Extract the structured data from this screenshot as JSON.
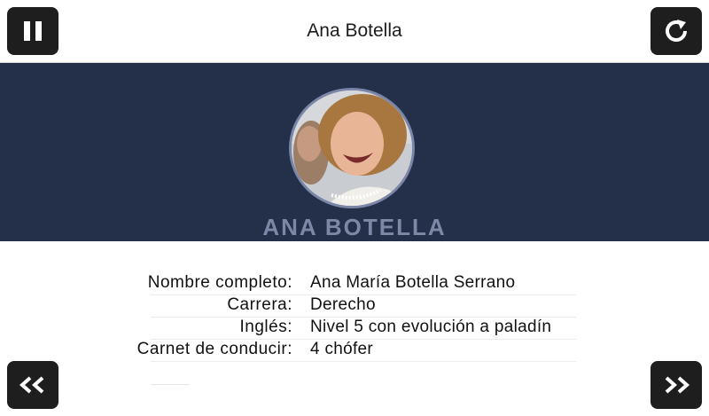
{
  "header": {
    "title": "Ana Botella",
    "pause_icon": "pause-icon",
    "reload_icon": "reload-icon"
  },
  "banner": {
    "name": "ANA BOTELLA",
    "background_color": "#24304a",
    "name_color": "#7c88a6"
  },
  "profile": {
    "fields": [
      {
        "label": "Nombre completo:",
        "value": "Ana María Botella Serrano"
      },
      {
        "label": "Carrera:",
        "value": "Derecho"
      },
      {
        "label": "Inglés:",
        "value": "Nivel 5 con evolución a paladín"
      },
      {
        "label": "Carnet de conducir:",
        "value": "4 chófer"
      }
    ]
  },
  "footer": {
    "prev_icon": "double-chevron-left-icon",
    "next_icon": "double-chevron-right-icon"
  }
}
